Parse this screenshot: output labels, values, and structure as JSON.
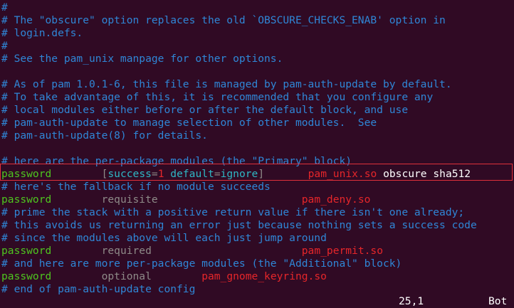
{
  "editor": {
    "lines": [
      [
        {
          "text": "#",
          "color": "comment"
        }
      ],
      [
        {
          "text": "# The \"obscure\" option replaces the old `OBSCURE_CHECKS_ENAB' option in",
          "color": "comment"
        }
      ],
      [
        {
          "text": "# login.defs.",
          "color": "comment"
        }
      ],
      [
        {
          "text": "#",
          "color": "comment"
        }
      ],
      [
        {
          "text": "# See the pam_unix manpage for other options.",
          "color": "comment"
        }
      ],
      [
        {
          "text": "",
          "color": "comment"
        }
      ],
      [
        {
          "text": "# As of pam 1.0.1-6, this file is managed by pam-auth-update by default.",
          "color": "comment"
        }
      ],
      [
        {
          "text": "# To take advantage of this, it is recommended that you configure any",
          "color": "comment"
        }
      ],
      [
        {
          "text": "# local modules either before or after the default block, and use",
          "color": "comment"
        }
      ],
      [
        {
          "text": "# pam-auth-update to manage selection of other modules.  See",
          "color": "comment"
        }
      ],
      [
        {
          "text": "# pam-auth-update(8) for details.",
          "color": "comment"
        }
      ],
      [
        {
          "text": "",
          "color": "comment"
        }
      ],
      [
        {
          "text": "# here are the per-package modules (the \"Primary\" block)",
          "color": "comment"
        }
      ],
      [
        {
          "text": "password",
          "color": "green"
        },
        {
          "text": "        ",
          "color": "white"
        },
        {
          "text": "[",
          "color": "gray"
        },
        {
          "text": "success",
          "color": "cyan"
        },
        {
          "text": "=",
          "color": "gray"
        },
        {
          "text": "1",
          "color": "red"
        },
        {
          "text": " ",
          "color": "gray"
        },
        {
          "text": "default",
          "color": "cyan"
        },
        {
          "text": "=",
          "color": "gray"
        },
        {
          "text": "ignore",
          "color": "cyan"
        },
        {
          "text": "]",
          "color": "gray"
        },
        {
          "text": "       ",
          "color": "white"
        },
        {
          "text": "pam_unix.so",
          "color": "red"
        },
        {
          "text": " obscure sha512",
          "color": "white"
        }
      ],
      [
        {
          "text": "# here's the fallback if no module succeeds",
          "color": "comment"
        }
      ],
      [
        {
          "text": "password",
          "color": "green"
        },
        {
          "text": "        ",
          "color": "white"
        },
        {
          "text": "requisite",
          "color": "gray"
        },
        {
          "text": "                       ",
          "color": "white"
        },
        {
          "text": "pam_deny.so",
          "color": "red"
        }
      ],
      [
        {
          "text": "# prime the stack with a positive return value if there isn't one already;",
          "color": "comment"
        }
      ],
      [
        {
          "text": "# this avoids us returning an error just because nothing sets a success code",
          "color": "comment"
        }
      ],
      [
        {
          "text": "# since the modules above will each just jump around",
          "color": "comment"
        }
      ],
      [
        {
          "text": "password",
          "color": "green"
        },
        {
          "text": "        ",
          "color": "white"
        },
        {
          "text": "required",
          "color": "gray"
        },
        {
          "text": "                        ",
          "color": "white"
        },
        {
          "text": "pam_permit.so",
          "color": "red"
        }
      ],
      [
        {
          "text": "# and here are more per-package modules (the \"Additional\" block)",
          "color": "comment"
        }
      ],
      [
        {
          "text": "password",
          "color": "green"
        },
        {
          "text": "        ",
          "color": "white"
        },
        {
          "text": "optional",
          "color": "gray"
        },
        {
          "text": "        ",
          "color": "white"
        },
        {
          "text": "pam_gnome_keyring.so",
          "color": "red"
        }
      ],
      [
        {
          "text": "# end of pam-auth-update config",
          "color": "comment"
        }
      ]
    ],
    "status": {
      "position": "25,1",
      "scroll": "Bot"
    }
  },
  "colors": {
    "background": "#300a24",
    "comment": "#2f86d6",
    "green": "#4ec51f",
    "gray": "#8e8a88",
    "red": "#e6262a",
    "white": "#ffffff",
    "cyan": "#2fb7c4",
    "highlight_box": "#e0303a"
  }
}
